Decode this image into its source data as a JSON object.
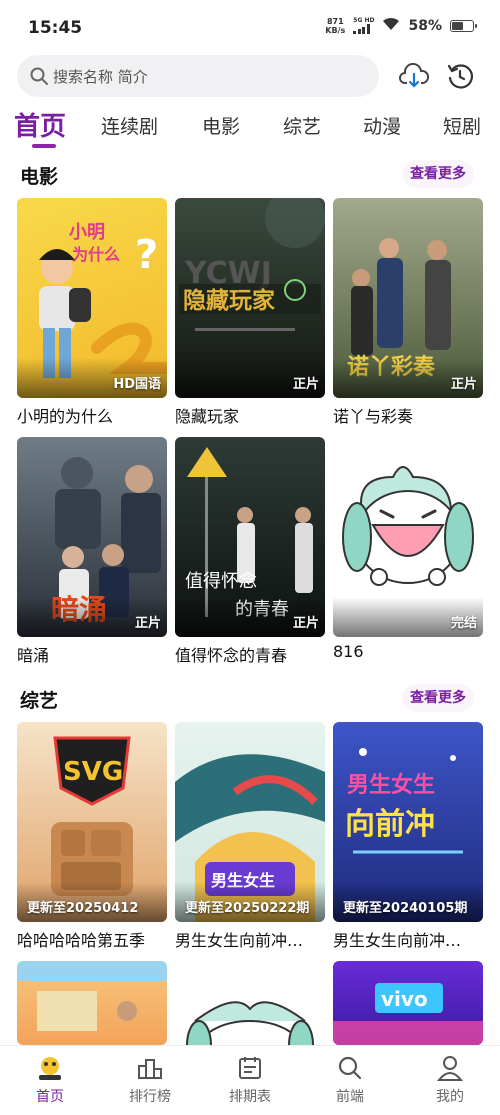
{
  "status": {
    "time": "15:45",
    "net_speed_value": "871",
    "net_speed_unit": "KB/s",
    "signal_label": "5G HD",
    "battery_percent": "58%",
    "battery_level": 0.58
  },
  "search": {
    "placeholder": "搜索名称 简介"
  },
  "tabs": [
    {
      "label": "首页",
      "active": true
    },
    {
      "label": "连续剧"
    },
    {
      "label": "电影"
    },
    {
      "label": "综艺"
    },
    {
      "label": "动漫"
    },
    {
      "label": "短剧"
    }
  ],
  "sections": {
    "movies": {
      "title": "电影",
      "more": "查看更多",
      "items": [
        {
          "title": "小明的为什么",
          "badge": "HD国语",
          "poster_text": "小明的为什么"
        },
        {
          "title": "隐藏玩家",
          "badge": "正片",
          "poster_text": "隐藏玩家"
        },
        {
          "title": "诺丫与彩奏",
          "badge": "正片",
          "poster_text": "诺丫与彩奏"
        },
        {
          "title": "暗涌",
          "badge": "正片",
          "poster_text": "暗涌"
        },
        {
          "title": "值得怀念的青春",
          "badge": "正片",
          "poster_text": "值得怀念的青春"
        },
        {
          "title": "816",
          "badge": "完结"
        }
      ]
    },
    "variety": {
      "title": "综艺",
      "more": "查看更多",
      "items": [
        {
          "title": "哈哈哈哈哈第五季",
          "badge": "更新至20250412",
          "poster_text": "SVG"
        },
        {
          "title": "男生女生向前冲…",
          "badge": "更新至20250222期",
          "poster_text": "男生女生向前冲"
        },
        {
          "title": "男生女生向前冲…",
          "badge": "更新至20240105期",
          "poster_text": "男生女生向前冲"
        }
      ]
    }
  },
  "bottom_nav": [
    {
      "label": "首页",
      "icon": "home-logo-icon",
      "active": true
    },
    {
      "label": "排行榜",
      "icon": "podium-icon"
    },
    {
      "label": "排期表",
      "icon": "schedule-icon"
    },
    {
      "label": "前端",
      "icon": "search-icon"
    },
    {
      "label": "我的",
      "icon": "user-icon"
    }
  ],
  "colors": {
    "accent": "#7b1fa2",
    "search_bg": "#f1f1f3"
  }
}
